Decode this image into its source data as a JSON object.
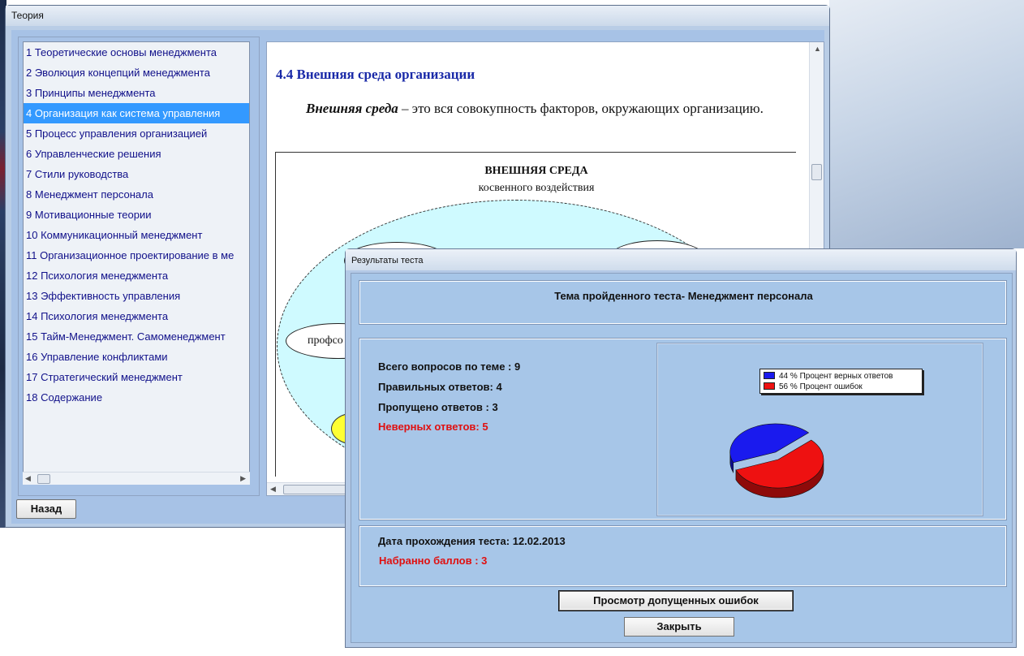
{
  "theory_window": {
    "title": "Теория",
    "toc": [
      "1 Теоретические основы менеджмента",
      "2 Эволюция концепций менеджмента",
      "3 Принципы менеджмента",
      "4 Организация как система управления",
      "5 Процесс управления организацией",
      "6 Управленческие решения",
      "7 Стили руководства",
      "8 Менеджмент персонала",
      "9 Мотивационные теории",
      "10 Коммуникационный менеджмент",
      "11 Организационное проектирование в ме",
      "12  Психология менеджмента",
      "13 Эффективность управления",
      "14 Психология менеджмента",
      "15 Тайм-Менеджмент. Самоменеджмент",
      "16 Управление конфликтами",
      "17 Стратегический менеджмент",
      "18 Содержание"
    ],
    "selected_index": 3,
    "doc": {
      "heading": "4.4 Внешняя среда организации",
      "term": "Внешняя среда",
      "definition": " – это вся совокупность факторов, окружающих организацию.",
      "diagram_title": "ВНЕШНЯЯ СРЕДА",
      "diagram_subtitle": "косвенного воздействия",
      "diagram_node": "профсо"
    },
    "back_label": "Назад"
  },
  "results_window": {
    "title": "Результаты теста",
    "topic": "Тема пройденного теста- Менеджмент персонала",
    "total": "Всего вопросов по теме : 9",
    "correct": "Правильных ответов: 4",
    "skipped": "Пропущено ответов : 3",
    "wrong": "Неверных ответов: 5",
    "date": "Дата прохождения теста: 12.02.2013",
    "score": "Набранно баллов : 3",
    "view_errors_label": "Просмотр допущенных ошибок",
    "close_label": "Закрыть",
    "legend": [
      {
        "label": "44 % Процент верных ответов",
        "color": "#1a1aee"
      },
      {
        "label": "56 % Процент ошибок",
        "color": "#ee1111"
      }
    ]
  },
  "chart_data": {
    "type": "pie",
    "categories": [
      "Процент верных ответов",
      "Процент ошибок"
    ],
    "values": [
      44,
      56
    ],
    "colors": [
      "#1a1aee",
      "#ee1111"
    ],
    "style": "3d",
    "legend_placement": "top"
  }
}
